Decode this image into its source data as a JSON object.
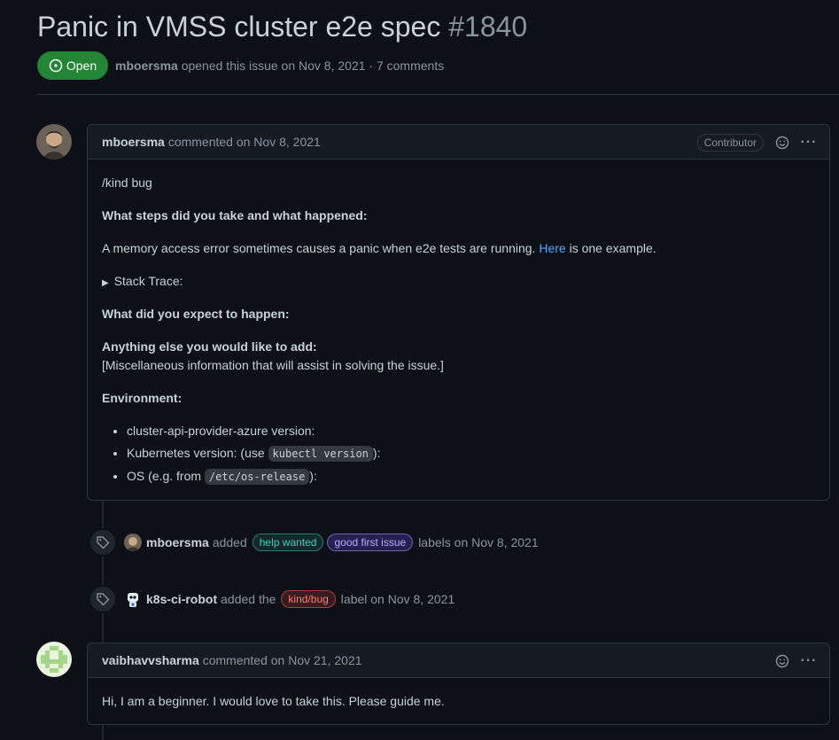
{
  "issue": {
    "title": "Panic in VMSS cluster e2e spec",
    "number": "#1840",
    "state": "Open",
    "author": "mboersma",
    "meta_text": "opened this issue on Nov 8, 2021 · 7 comments"
  },
  "comments": [
    {
      "author": "mboersma",
      "timestamp": "commented on Nov 8, 2021",
      "badge": "Contributor",
      "body": {
        "kind": "/kind bug",
        "steps_heading": "What steps did you take and what happened:",
        "steps_text_before": "A memory access error sometimes causes a panic when e2e tests are running.",
        "steps_link": "Here",
        "steps_text_after": "is one example.",
        "stack_trace": "Stack Trace:",
        "expect_heading": "What did you expect to happen:",
        "else_heading": "Anything else you would like to add:",
        "else_text": "[Miscellaneous information that will assist in solving the issue.]",
        "env_heading": "Environment:",
        "env_items": {
          "capz": "cluster-api-provider-azure version:",
          "k8s_before": "Kubernetes version: (use",
          "k8s_code": "kubectl version",
          "k8s_after": "):",
          "os_before": "OS (e.g. from",
          "os_code": "/etc/os-release",
          "os_after": "):"
        }
      }
    },
    {
      "author": "vaibhavvsharma",
      "timestamp": "commented on Nov 21, 2021",
      "body": "Hi, I am a beginner. I would love to take this. Please guide me."
    }
  ],
  "events": [
    {
      "actor": "mboersma",
      "action": "added",
      "labels": [
        "help wanted",
        "good first issue"
      ],
      "suffix": "labels on Nov 8, 2021"
    },
    {
      "actor": "k8s-ci-robot",
      "action": "added the",
      "labels": [
        "kind/bug"
      ],
      "suffix": "label on Nov 8, 2021"
    }
  ],
  "colors": {
    "open": "#238636",
    "link": "#58a6ff",
    "label_help_wanted": "#39d3bb",
    "label_good_first": "#9f8df5",
    "label_kind_bug": "#f85149"
  }
}
